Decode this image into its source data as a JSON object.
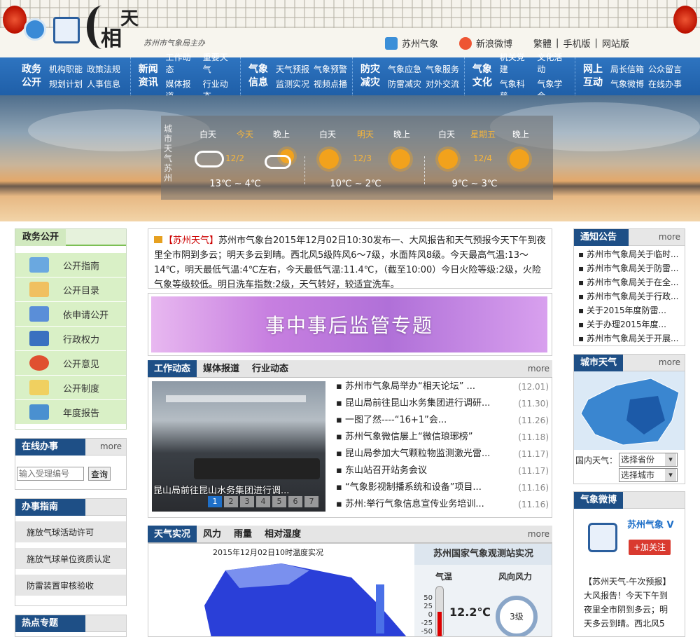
{
  "header": {
    "brand_main": "相",
    "brand_top": "天",
    "brand_sub": "苏州市气象局主办",
    "links": {
      "wechat": "苏州气象",
      "weibo": "新浪微博",
      "traditional": "繁體",
      "mobile": "手机版",
      "sitemap": "网站版"
    }
  },
  "nav": [
    {
      "title1": "政务",
      "title2": "公开",
      "links": [
        "机构职能",
        "政策法规",
        "规划计划",
        "人事信息"
      ]
    },
    {
      "title1": "新闻",
      "title2": "资讯",
      "links": [
        "工作动态",
        "重要天气",
        "媒体报道",
        "行业动态"
      ]
    },
    {
      "title1": "气象",
      "title2": "信息",
      "links": [
        "天气预报",
        "气象预警",
        "监测实况",
        "视频点播"
      ]
    },
    {
      "title1": "防灾",
      "title2": "减灾",
      "links": [
        "气象应急",
        "气象服务",
        "防雷减灾",
        "对外交流"
      ]
    },
    {
      "title1": "气象",
      "title2": "文化",
      "links": [
        "机关党建",
        "文化活动",
        "气象科普",
        "气象学会"
      ]
    },
    {
      "title1": "网上",
      "title2": "互动",
      "links": [
        "局长信箱",
        "公众留言",
        "气象微博",
        "在线办事"
      ]
    }
  ],
  "weather": {
    "side": "城市天气苏州",
    "days": [
      {
        "day": "白天",
        "mid": "今天",
        "night": "晚上",
        "date": "12/2",
        "temp": "13℃ ~ 4℃"
      },
      {
        "day": "白天",
        "mid": "明天",
        "night": "晚上",
        "date": "12/3",
        "temp": "10℃ ~ 2℃"
      },
      {
        "day": "白天",
        "mid": "星期五",
        "night": "晚上",
        "date": "12/4",
        "temp": "9℃ ~ 3℃"
      }
    ]
  },
  "left": {
    "gov_title": "政务公开",
    "gov_items": [
      "公开指南",
      "公开目录",
      "依申请公开",
      "行政权力",
      "公开意见",
      "公开制度",
      "年度报告"
    ],
    "online_title": "在线办事",
    "more": "more",
    "online_placeholder": "输入受理编号",
    "online_button": "查询",
    "guide_title": "办事指南",
    "guide_items": [
      "施放气球活动许可",
      "施放气球单位资质认定",
      "防雷装置审核验收"
    ],
    "hot_title": "热点专题"
  },
  "center": {
    "notice_tag": "【苏州天气】",
    "notice_text": "苏州市气象台2015年12月02日10:30发布一、大风报告和天气预报今天下午到夜里全市阴到多云；明天多云到晴。西北风5级阵风6～7级，水面阵风8级。今天最高气温:13～14℃，明天最低气温:4℃左右，今天最低气温:11.4℃，（截至10:00）今日火险等级:2级，火险气象等级较低。明日洗车指数:2级，天气转好，较适宜洗车。",
    "promo_text": "事中事后监管专题",
    "news_tabs": [
      "工作动态",
      "媒体报道",
      "行业动态"
    ],
    "more": "more",
    "photo_caption": "昆山局前往昆山水务集团进行调...",
    "pages": [
      "1",
      "2",
      "3",
      "4",
      "5",
      "6",
      "7"
    ],
    "news": [
      {
        "title": "苏州市气象局举办“相天论坛” ...",
        "date": "(12.01)"
      },
      {
        "title": "昆山局前往昆山水务集团进行调研...",
        "date": "(11.30)"
      },
      {
        "title": "一图了然----“16+1”会...",
        "date": "(11.26)"
      },
      {
        "title": "苏州气象微信屡上“微信琅琊榜”",
        "date": "(11.18)"
      },
      {
        "title": "昆山局参加大气颗粒物监测激光雷...",
        "date": "(11.17)"
      },
      {
        "title": "东山站召开站务会议",
        "date": "(11.17)"
      },
      {
        "title": "“气象影视制播系统和设备”项目...",
        "date": "(11.16)"
      },
      {
        "title": "苏州:举行气象信息宣传业务培训...",
        "date": "(11.16)"
      }
    ],
    "rt_tabs": [
      "天气实况",
      "风力",
      "雨量",
      "相对湿度"
    ],
    "map_title": "2015年12月02日10时温度实况",
    "station_title": "苏州国家气象观测站实况",
    "temp_label": "气温",
    "temp_value": "12.2℃",
    "wind_label": "风向风力",
    "wind_value": "3级",
    "scale": [
      "50",
      "25",
      "0",
      "-25",
      "-50"
    ]
  },
  "right": {
    "notice_title": "通知公告",
    "more": "more",
    "notices": [
      "苏州市气象局关于临时...",
      "苏州市气象局关于防雷...",
      "苏州市气象局关于在全...",
      "苏州市气象局关于行政...",
      "关于2015年度防雷...",
      "关于办理2015年度...",
      "苏州市气象局关于开展..."
    ],
    "city_title": "城市天气",
    "domestic_label": "国内天气：",
    "province_select": "选择省份",
    "city_select": "选择城市",
    "weibo_title": "气象微博",
    "weibo_name": "苏州气象",
    "follow": "+加关注",
    "weibo_text": "【苏州天气-午次预报】大风报告！今天下午到夜里全市阴到多云；明天多云到晴。西北风5"
  }
}
